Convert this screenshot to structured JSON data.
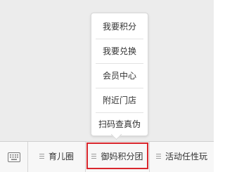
{
  "popup_menu": {
    "items": [
      {
        "label": "我要积分"
      },
      {
        "label": "我要兑换"
      },
      {
        "label": "会员中心"
      },
      {
        "label": "附近门店"
      },
      {
        "label": "扫码查真伪"
      }
    ]
  },
  "bottom_bar": {
    "keyboard_icon": "keyboard-icon",
    "tabs": [
      {
        "label": "育儿圈",
        "icon": "menu-lines-icon"
      },
      {
        "label": "御妈积分团",
        "icon": "menu-lines-icon",
        "highlighted": true
      },
      {
        "label": "活动任性玩",
        "icon": "menu-lines-icon"
      }
    ]
  },
  "colors": {
    "highlight_border": "#d9262c",
    "background": "#ececec",
    "bar_background": "#f7f7f7"
  }
}
